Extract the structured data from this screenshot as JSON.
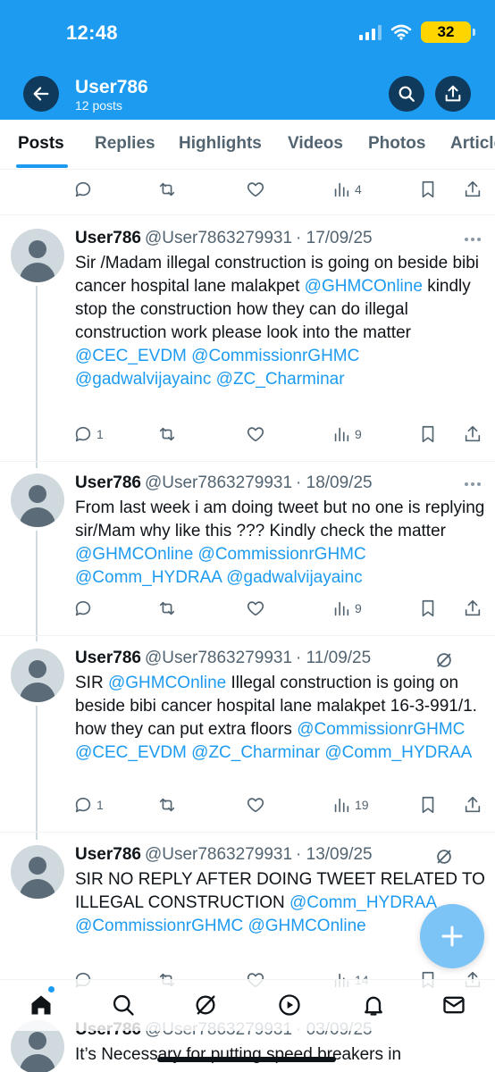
{
  "status_bar": {
    "time": "12:48",
    "battery": "32"
  },
  "header": {
    "name": "User786",
    "post_count": "12 posts"
  },
  "tabs": [
    "Posts",
    "Replies",
    "Highlights",
    "Videos",
    "Photos",
    "Articles"
  ],
  "top_actions": {
    "views": "4"
  },
  "posts": [
    {
      "name": "User786",
      "handle": "@User7863279931",
      "date": "· 17/09/25",
      "text_parts": [
        {
          "t": "Sir /Madam illegal construction is going on beside bibi cancer hospital lane malakpet "
        },
        {
          "t": "@GHMCOnline",
          "m": true
        },
        {
          "t": " kindly stop the construction how they can do illegal construction work please look into the matter "
        },
        {
          "t": "@CEC_EVDM",
          "m": true
        },
        {
          "t": " "
        },
        {
          "t": "@CommissionrGHMC",
          "m": true
        },
        {
          "t": " "
        },
        {
          "t": "@gadwalvijayainc",
          "m": true
        },
        {
          "t": " "
        },
        {
          "t": "@ZC_Charminar",
          "m": true
        }
      ],
      "replies": "1",
      "views": "9"
    },
    {
      "name": "User786",
      "handle": "@User7863279931",
      "date": "· 18/09/25",
      "text_parts": [
        {
          "t": "From last week i am doing tweet but no one is replying sir/Mam why like this ??? Kindly check the matter "
        },
        {
          "t": "@GHMCOnline",
          "m": true
        },
        {
          "t": " "
        },
        {
          "t": "@CommissionrGHMC",
          "m": true
        },
        {
          "t": " "
        },
        {
          "t": "@Comm_HYDRAA",
          "m": true
        },
        {
          "t": " "
        },
        {
          "t": "@gadwalvijayainc",
          "m": true
        }
      ],
      "replies": "",
      "views": "9"
    },
    {
      "name": "User786",
      "handle": "@User7863279931",
      "date": "· 11/09/25",
      "text_parts": [
        {
          "t": "SIR "
        },
        {
          "t": "@GHMCOnline",
          "m": true
        },
        {
          "t": " Illegal construction is going on beside bibi cancer hospital lane malakpet 16-3-991/1. how they can put extra floors "
        },
        {
          "t": "@CommissionrGHMC",
          "m": true
        },
        {
          "t": " "
        },
        {
          "t": "@CEC_EVDM",
          "m": true
        },
        {
          "t": " "
        },
        {
          "t": "@ZC_Charminar",
          "m": true
        },
        {
          "t": " "
        },
        {
          "t": "@Comm_HYDRAA",
          "m": true
        }
      ],
      "replies": "1",
      "views": "19"
    },
    {
      "name": "User786",
      "handle": "@User7863279931",
      "date": "· 13/09/25",
      "text_parts": [
        {
          "t": "SIR NO REPLY AFTER DOING TWEET RELATED TO ILLEGAL CONSTRUCTION "
        },
        {
          "t": "@Comm_HYDRAA",
          "m": true
        },
        {
          "t": " "
        },
        {
          "t": "@CommissionrGHMC",
          "m": true
        },
        {
          "t": " "
        },
        {
          "t": "@GHMCOnline",
          "m": true
        }
      ],
      "replies": "",
      "views": "14"
    },
    {
      "name": "User786",
      "handle": "@User7863279931",
      "date": "· 03/09/25",
      "text_parts": [
        {
          "t": "It’s Necessary for putting speed breakers in"
        }
      ],
      "replies": "",
      "views": ""
    }
  ],
  "colors": {
    "brand": "#1d9bf0",
    "header_bg": "#1d9bf0",
    "text_secondary": "#536471"
  }
}
